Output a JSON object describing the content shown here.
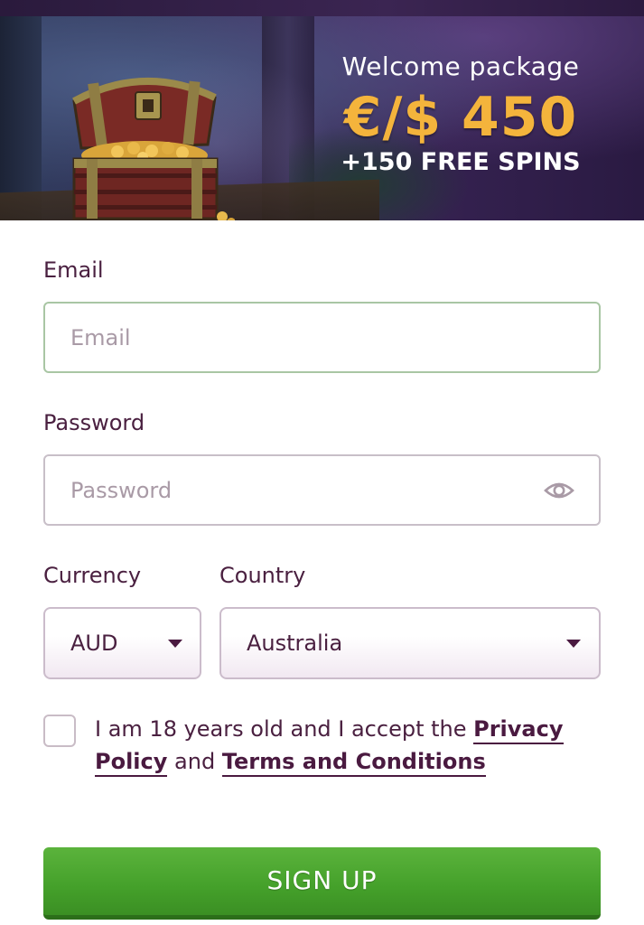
{
  "banner": {
    "welcome": "Welcome package",
    "amount": "€/$ 450",
    "spins": "+150 FREE SPINS",
    "image_icon": "treasure-chest-icon"
  },
  "form": {
    "email": {
      "label": "Email",
      "placeholder": "Email",
      "value": ""
    },
    "password": {
      "label": "Password",
      "placeholder": "Password",
      "value": "",
      "toggle_icon": "eye-icon"
    },
    "currency": {
      "label": "Currency",
      "value": "AUD"
    },
    "country": {
      "label": "Country",
      "value": "Australia"
    },
    "consent": {
      "text_before": "I am 18 years old and I accept the ",
      "privacy_link": "Privacy Policy",
      "text_middle": " and ",
      "terms_link": "Terms and Conditions",
      "checked": false
    },
    "submit_label": "SIGN UP"
  },
  "colors": {
    "accent_gold": "#f4b43c",
    "text_plum": "#4a2040",
    "button_green": "#44a02a"
  }
}
